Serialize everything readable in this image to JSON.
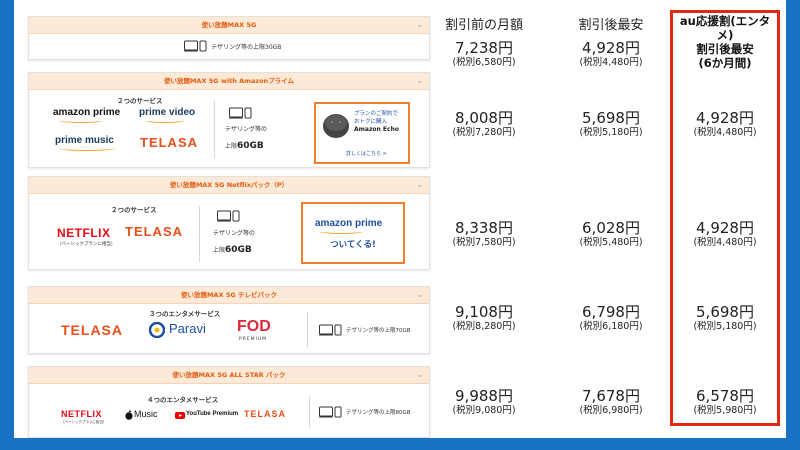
{
  "column_headers": {
    "before": "割引前の月額",
    "after": "割引後最安",
    "au_line1": "au応援割(エンタメ)",
    "au_line2": "割引後最安",
    "au_line3": "(6か月間)"
  },
  "plans": [
    {
      "header": "使い放題MAX 5G",
      "tether": "テザリング等の上限30GB",
      "prices": {
        "before": "7,238円",
        "before_tax": "(税別6,580円)",
        "after": "4,928円",
        "after_tax": "(税別4,480円)",
        "au": "",
        "au_tax": ""
      }
    },
    {
      "header": "使い放題MAX 5G with Amazonプライム",
      "services_title": "２つのサービス",
      "logos": {
        "amazon_prime": "amazon prime",
        "prime_video": "prime video",
        "prime_music": "prime music",
        "telasa": "TELASA"
      },
      "tether_line1": "テザリング等の",
      "tether_line2_prefix": "上限",
      "tether_line2_value": "60GB",
      "promo": {
        "line1": "プランのご契約で",
        "line2": "おトクに購入",
        "line3": "Amazon Echo",
        "link": "詳しくはこちら >"
      },
      "prices": {
        "before": "8,008円",
        "before_tax": "(税別7,280円)",
        "after": "5,698円",
        "after_tax": "(税別5,180円)",
        "au": "4,928円",
        "au_tax": "(税別4,480円)"
      }
    },
    {
      "header": "使い放題MAX 5G Netflixパック（P）",
      "services_title": "２つのサービス",
      "logos": {
        "netflix": "NETFLIX",
        "netflix_sub": "（ベーシックプランに相当）",
        "telasa": "TELASA"
      },
      "tether_line1": "テザリング等の",
      "tether_line2_prefix": "上限",
      "tether_line2_value": "60GB",
      "promo": {
        "line1": "amazon prime",
        "line2": "ついてくる!"
      },
      "prices": {
        "before": "8,338円",
        "before_tax": "(税別7,580円)",
        "after": "6,028円",
        "after_tax": "(税別5,480円)",
        "au": "4,928円",
        "au_tax": "(税別4,480円)"
      }
    },
    {
      "header": "使い放題MAX 5G テレビパック",
      "services_title": "３つのエンタメサービス",
      "logos": {
        "telasa": "TELASA",
        "paravi": "Paravi",
        "fod": "FOD",
        "fod_sub": "PREMIUM"
      },
      "tether": "テザリング等の上限70GB",
      "prices": {
        "before": "9,108円",
        "before_tax": "(税別8,280円)",
        "after": "6,798円",
        "after_tax": "(税別6,180円)",
        "au": "5,698円",
        "au_tax": "(税別5,180円)"
      }
    },
    {
      "header": "使い放題MAX 5G ALL STAR パック",
      "services_title": "４つのエンタメサービス",
      "logos": {
        "netflix": "NETFLIX",
        "netflix_sub": "（ベーシックプランに相当）",
        "music": "Music",
        "youtube": "YouTube Premium",
        "telasa": "TELASA"
      },
      "tether": "テザリング等の上限80GB",
      "prices": {
        "before": "9,988円",
        "before_tax": "(税別9,080円)",
        "after": "7,678円",
        "after_tax": "(税別6,980円)",
        "au": "6,578円",
        "au_tax": "(税別5,980円)"
      }
    }
  ],
  "colors": {
    "accent_orange": "#ef7f2d",
    "frame_blue": "#1a72c4",
    "highlight_red": "#e02a10"
  }
}
